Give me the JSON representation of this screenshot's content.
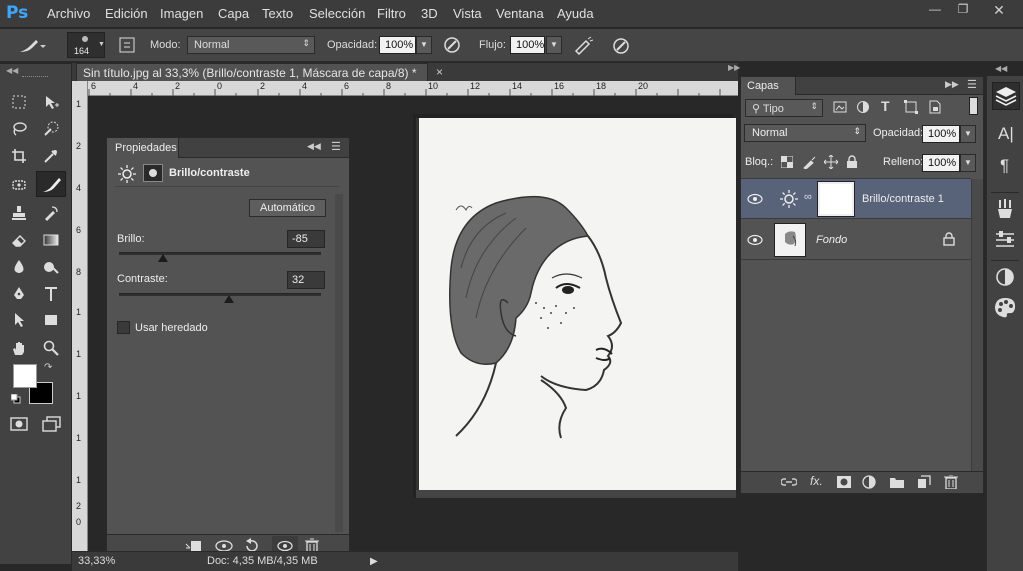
{
  "app": {
    "logo": "Ps"
  },
  "menu": [
    "Archivo",
    "Edición",
    "Imagen",
    "Capa",
    "Texto",
    "Selección",
    "Filtro",
    "3D",
    "Vista",
    "Ventana",
    "Ayuda"
  ],
  "options": {
    "brush_size": "164",
    "mode_label": "Modo:",
    "mode_value": "Normal",
    "opacity_label": "Opacidad:",
    "opacity_value": "100%",
    "flow_label": "Flujo:",
    "flow_value": "100%"
  },
  "document": {
    "tab_title": "Sin título.jpg al 33,3% (Brillo/contraste 1, Máscara de capa/8) *",
    "close": "×",
    "ruler_top": [
      "6",
      "4",
      "2",
      "0",
      "2",
      "4",
      "6",
      "8",
      "10",
      "12",
      "14",
      "16",
      "18",
      "20"
    ],
    "ruler_left": [
      "1",
      "2",
      "4",
      "6",
      "8",
      "1",
      "1",
      "1",
      "2",
      "1",
      "4",
      "1",
      "6",
      "1",
      "8",
      "2",
      "0"
    ],
    "zoom": "33,33%",
    "doc_info": "Doc: 4,35 MB/4,35 MB"
  },
  "properties": {
    "tab": "Propiedades",
    "title": "Brillo/contraste",
    "auto_button": "Automático",
    "brightness_label": "Brillo:",
    "brightness_value": "-85",
    "brightness_level": -85,
    "contrast_label": "Contraste:",
    "contrast_value": "32",
    "contrast_level": 32,
    "legacy_label": "Usar heredado",
    "legacy_checked": false
  },
  "layers": {
    "tab": "Capas",
    "filter_kind": "Tipo",
    "blend_mode": "Normal",
    "opacity_label": "Opacidad:",
    "opacity_value": "100%",
    "lock_label": "Bloq.:",
    "fill_label": "Relleno:",
    "fill_value": "100%",
    "items": [
      {
        "name": "Brillo/contraste 1",
        "selected": true
      },
      {
        "name": "Fondo",
        "selected": false,
        "locked": true
      }
    ]
  },
  "colors": {
    "foreground": "#ffffff",
    "background": "#000000",
    "selection": "#58637a"
  }
}
